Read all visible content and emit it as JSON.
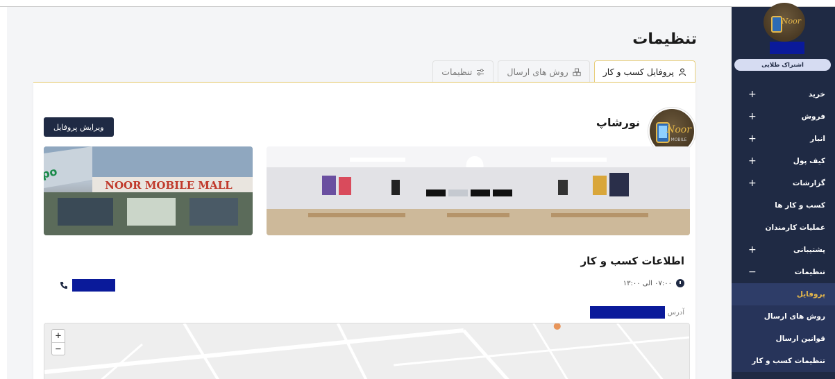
{
  "page": {
    "title": "تنظیمات"
  },
  "tabs": [
    {
      "label": "پروفایل کسب و کار",
      "icon": "user-icon",
      "active": true
    },
    {
      "label": "روش های ارسال",
      "icon": "boxes-icon",
      "active": false
    },
    {
      "label": "تنظیمات",
      "icon": "sliders-icon",
      "active": false
    }
  ],
  "profile": {
    "shop_name": "نورشاپ",
    "edit_button": "ویرایش پروفایل",
    "banner_side_text": "NOOR MOBILE MALL"
  },
  "business_info": {
    "title": "اطلاعات کسب و کار",
    "hours": "۰۷:۰۰ الی ۱۳:۰۰",
    "address_label": "آدرس"
  },
  "map": {
    "zoom_in": "+",
    "zoom_out": "−"
  },
  "sidebar": {
    "badge": "اشتراک طلایی",
    "items": [
      {
        "label": "خرید",
        "sign": "+"
      },
      {
        "label": "فروش",
        "sign": "+"
      },
      {
        "label": "انبار",
        "sign": "+"
      },
      {
        "label": "کیف پول",
        "sign": "+"
      },
      {
        "label": "گزارشات",
        "sign": "+"
      },
      {
        "label": "کسب و کار ها",
        "sign": ""
      },
      {
        "label": "عملیات کارمندان",
        "sign": ""
      },
      {
        "label": "پشتیبانی",
        "sign": "+"
      },
      {
        "label": "تنظیمات",
        "sign": "−"
      }
    ],
    "subitems": [
      {
        "label": "پروفایل",
        "current": true
      },
      {
        "label": "روش های ارسال",
        "current": false
      },
      {
        "label": "قوانین ارسال",
        "current": false
      },
      {
        "label": "تنظیمات کسب و کار",
        "current": false
      }
    ]
  },
  "colors": {
    "sidebar_bg": "#1f2a44",
    "accent": "#e6b84a",
    "tab_border": "#e8cf7d",
    "redaction": "#0a1a9a"
  }
}
